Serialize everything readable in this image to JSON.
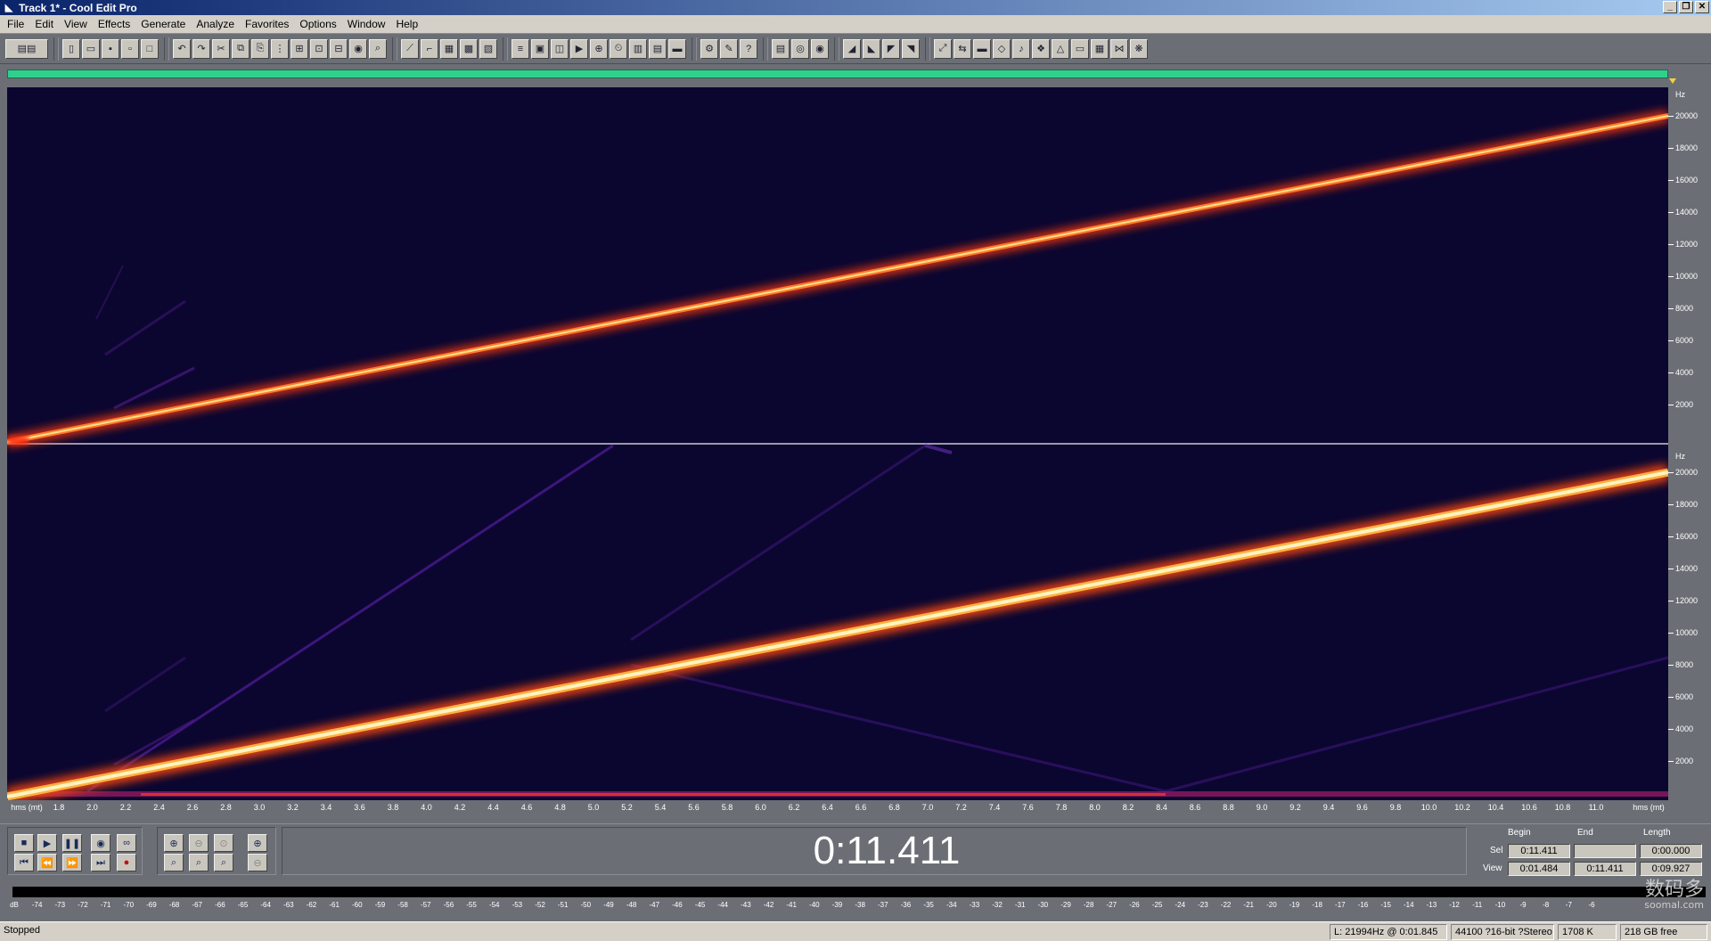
{
  "window": {
    "title": "Track 1* - Cool Edit Pro"
  },
  "menu": [
    "File",
    "Edit",
    "View",
    "Effects",
    "Generate",
    "Analyze",
    "Favorites",
    "Options",
    "Window",
    "Help"
  ],
  "spectrogram": {
    "hz_unit": "Hz",
    "hz_labels": [
      "20000",
      "18000",
      "16000",
      "14000",
      "12000",
      "10000",
      "8000",
      "6000",
      "4000",
      "2000"
    ],
    "time_unit": "hms (mt)",
    "time_labels": [
      "1.8",
      "2.0",
      "2.2",
      "2.4",
      "2.6",
      "2.8",
      "3.0",
      "3.2",
      "3.4",
      "3.6",
      "3.8",
      "4.0",
      "4.2",
      "4.4",
      "4.6",
      "4.8",
      "5.0",
      "5.2",
      "5.4",
      "5.6",
      "5.8",
      "6.0",
      "6.2",
      "6.4",
      "6.6",
      "6.8",
      "7.0",
      "7.2",
      "7.4",
      "7.6",
      "7.8",
      "8.0",
      "8.2",
      "8.4",
      "8.6",
      "8.8",
      "9.0",
      "9.2",
      "9.4",
      "9.6",
      "9.8",
      "10.0",
      "10.2",
      "10.4",
      "10.6",
      "10.8",
      "11.0"
    ],
    "colors": {
      "background": "#0b0630",
      "sweep_core": "#fff4b0",
      "sweep_glow": "#ff5a1f",
      "harmonic": "#5a1f9c"
    }
  },
  "transport": {
    "current_time": "0:11.411"
  },
  "selection": {
    "headers": {
      "begin": "Begin",
      "end": "End",
      "length": "Length"
    },
    "sel": {
      "label": "Sel",
      "begin": "0:11.411",
      "end": "",
      "length": "0:00.000"
    },
    "view": {
      "label": "View",
      "begin": "0:01.484",
      "end": "0:11.411",
      "length": "0:09.927"
    }
  },
  "level_meter": {
    "labels": [
      "dB",
      "-74",
      "-73",
      "-72",
      "-71",
      "-70",
      "-69",
      "-68",
      "-67",
      "-66",
      "-65",
      "-64",
      "-63",
      "-62",
      "-61",
      "-60",
      "-59",
      "-58",
      "-57",
      "-56",
      "-55",
      "-54",
      "-53",
      "-52",
      "-51",
      "-50",
      "-49",
      "-48",
      "-47",
      "-46",
      "-45",
      "-44",
      "-43",
      "-42",
      "-41",
      "-40",
      "-39",
      "-38",
      "-37",
      "-36",
      "-35",
      "-34",
      "-33",
      "-32",
      "-31",
      "-30",
      "-29",
      "-28",
      "-27",
      "-26",
      "-25",
      "-24",
      "-23",
      "-22",
      "-21",
      "-20",
      "-19",
      "-18",
      "-17",
      "-16",
      "-15",
      "-14",
      "-13",
      "-12",
      "-11",
      "-10",
      "-9",
      "-8",
      "-7",
      "-6"
    ]
  },
  "status": {
    "state": "Stopped",
    "cursor": "L: 21994Hz @  0:01.845",
    "format": "44100 ?16-bit ?Stereo",
    "size": "1708 K",
    "free": "218 GB free"
  },
  "watermark": {
    "text": "数码多",
    "sub": "soomal.com"
  }
}
